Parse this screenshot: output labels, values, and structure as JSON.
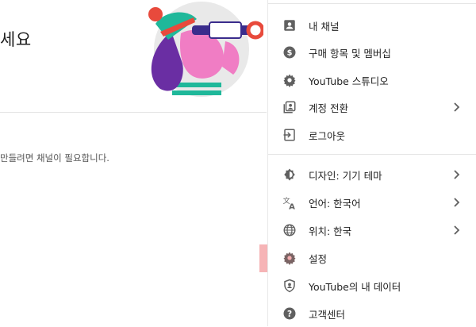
{
  "left": {
    "welcome_title": "세요",
    "channel_note": "만들려면 채널이 필요합니다."
  },
  "menu": {
    "items": [
      {
        "label": "내 채널",
        "icon": "account-box-icon",
        "has_arrow": false
      },
      {
        "label": "구매 항목 및 멤버십",
        "icon": "dollar-circle-icon",
        "has_arrow": false
      },
      {
        "label": "YouTube 스튜디오",
        "icon": "gear-icon",
        "has_arrow": false
      },
      {
        "label": "계정 전환",
        "icon": "switch-account-icon",
        "has_arrow": true
      },
      {
        "label": "로그아웃",
        "icon": "sign-out-icon",
        "has_arrow": false
      },
      {
        "label": "디자인: 기기 테마",
        "icon": "theme-icon",
        "has_arrow": true
      },
      {
        "label": "언어: 한국어",
        "icon": "translate-icon",
        "has_arrow": true
      },
      {
        "label": "위치: 한국",
        "icon": "globe-icon",
        "has_arrow": true
      },
      {
        "label": "설정",
        "icon": "gear-icon",
        "has_arrow": false,
        "highlighted": true
      },
      {
        "label": "YouTube의 내 데이터",
        "icon": "shield-person-icon",
        "has_arrow": false
      },
      {
        "label": "고객센터",
        "icon": "help-icon",
        "has_arrow": false
      }
    ]
  },
  "colors": {
    "highlight": "#f5aeb0",
    "icon": "#606060"
  }
}
